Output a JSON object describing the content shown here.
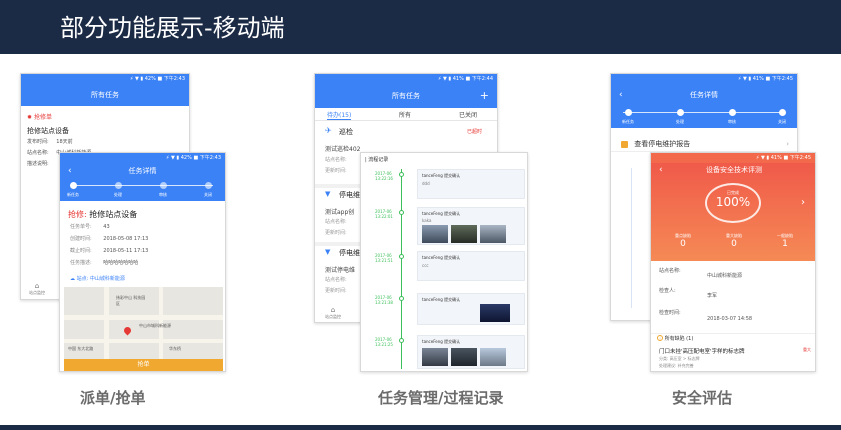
{
  "slide": {
    "title": "部分功能展示-移动端",
    "captions": [
      "派单/抢单",
      "任务管理/过程记录",
      "安全评估"
    ]
  },
  "colors": {
    "header_bg": "#1c2b45",
    "app_blue": "#3b82f6",
    "danger_red": "#e53935",
    "eval_orange": "#f26a4b",
    "caption_gray": "#6b6b6b"
  },
  "status": {
    "left": "⚡ ▼ ▮ 42% ■ 下午2:43",
    "mid": "⚡ ▼ ▮ 41% ■ 下午2:44",
    "right": "⚡ ▼ ▮ 41% ■ 下午2:45"
  },
  "phone1": {
    "back_screen": {
      "nav_title": "所有任务",
      "section_label": "抢修单",
      "task_title": "抢修站点设备",
      "rows": [
        {
          "label": "发布时间:",
          "value": "18天前"
        },
        {
          "label": "站点名称:",
          "value": "中山城科新能源"
        },
        {
          "label": "描述说明:",
          "value": ""
        }
      ],
      "bottom_nav_label": "站点监控"
    },
    "front_screen": {
      "nav_title": "任务详情",
      "steps": [
        "新任务",
        "处理",
        "审核",
        "关闭"
      ],
      "task_prefix": "抢修:",
      "task_name": "抢修站点设备",
      "fields": [
        {
          "label": "任务单号:",
          "value": "43"
        },
        {
          "label": "创建时间:",
          "value": "2018-05-08 17:13"
        },
        {
          "label": "截止时间:",
          "value": "2018-05-11 17:13"
        },
        {
          "label": "任务描述:",
          "value": "哈哈哈哈哈哈哈"
        }
      ],
      "site_line": "站点: 中山城科新能源",
      "map_labels": [
        "纬彩中山\n科技园区",
        "中山市城科新能源",
        "中国 东大北路",
        "华东桥"
      ],
      "action_button": "抢单"
    }
  },
  "phone2": {
    "back_screen": {
      "nav_title": "所有任务",
      "tabs": [
        "待办(15)",
        "所有",
        "已关闭"
      ],
      "items": [
        {
          "title": "巡检",
          "status": "已超时",
          "desc": "测试巡检402",
          "row1": "站点名称:",
          "row2": "更新时间:"
        },
        {
          "title": "停电维",
          "desc": "测试app创",
          "row1": "站点名称:",
          "row2": "更新时间:"
        },
        {
          "title": "停电维",
          "desc": "测试停电维",
          "row1": "站点名称:",
          "row2": "更新时间:"
        }
      ],
      "bottom_nav_label": "站点监控"
    },
    "front_screen": {
      "header": "流程记录",
      "entries": [
        {
          "date": "2017-06\n13:22:16",
          "user": "tanceFeng 提交确认",
          "note": "ddd"
        },
        {
          "date": "2017-06\n13:22:01",
          "user": "tanceFeng 提交确认",
          "note": "kaka"
        },
        {
          "date": "2017-06\n13:21:51",
          "user": "tanceFeng 提交确认",
          "note": "ccc"
        },
        {
          "date": "2017-06\n13:21:38",
          "user": "tanceFeng 提交确认",
          "note": ""
        },
        {
          "date": "2017-06\n13:21:25",
          "user": "tanceFeng 提交确认",
          "note": ""
        }
      ]
    }
  },
  "phone3": {
    "back_screen": {
      "nav_title": "任务详情",
      "steps": [
        "新任务",
        "处理",
        "审核",
        "关闭"
      ],
      "report_link": "查看停电维护报告"
    },
    "front_screen": {
      "nav_title": "设备安全技术评测",
      "score_label": "已完成",
      "score": "100%",
      "counts": [
        {
          "label": "重点缺陷",
          "value": "0"
        },
        {
          "label": "重大缺陷",
          "value": "0"
        },
        {
          "label": "一般缺陷",
          "value": "1"
        }
      ],
      "fields": [
        {
          "label": "站点名称:",
          "value": "中山城科新能源"
        },
        {
          "label": "检查人:",
          "value": "李军"
        },
        {
          "label": "检查时间:",
          "value": "2018-03-07 14:58"
        }
      ],
      "defect_header": "所有缺陷 (1)",
      "defect_title": "门口未挂'高压配电室'字样的标志牌",
      "defect_badge": "重大",
      "defect_detail1": "分类: 高压室 > 标志牌",
      "defect_detail2": "处理建议: 补充完善"
    }
  }
}
